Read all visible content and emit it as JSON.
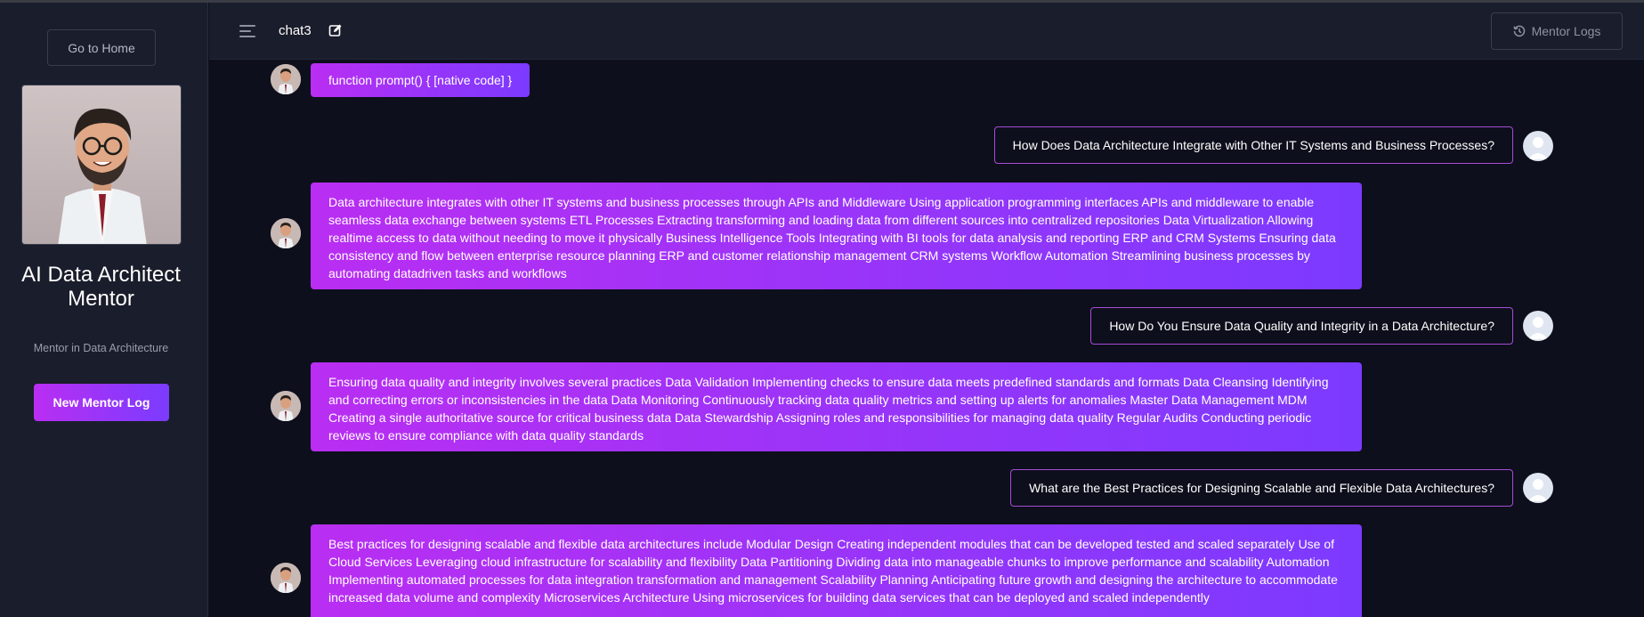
{
  "sidebar": {
    "home_label": "Go to Home",
    "mentor_name": "AI Data Architect Mentor",
    "mentor_subtitle": "Mentor in Data Architecture",
    "new_log_label": "New Mentor Log"
  },
  "header": {
    "chat_title": "chat3",
    "logs_label": "Mentor Logs"
  },
  "colors": {
    "accent_start": "#b92ef2",
    "accent_end": "#7a3cff",
    "background": "#0d0f1c",
    "panel": "#1a1d2b"
  },
  "messages": [
    {
      "role": "bot",
      "text": "function prompt() { [native code] }"
    },
    {
      "role": "user",
      "text": "How Does Data Architecture Integrate with Other IT Systems and Business Processes?"
    },
    {
      "role": "bot",
      "text": "Data architecture integrates with other IT systems and business processes through APIs and Middleware Using application programming interfaces APIs and middleware to enable seamless data exchange between systems ETL Processes Extracting transforming and loading data from different sources into centralized repositories Data Virtualization Allowing realtime access to data without needing to move it physically Business Intelligence Tools Integrating with BI tools for data analysis and reporting ERP and CRM Systems Ensuring data consistency and flow between enterprise resource planning ERP and customer relationship management CRM systems Workflow Automation Streamlining business processes by automating datadriven tasks and workflows"
    },
    {
      "role": "user",
      "text": "How Do You Ensure Data Quality and Integrity in a Data Architecture?"
    },
    {
      "role": "bot",
      "text": "Ensuring data quality and integrity involves several practices Data Validation Implementing checks to ensure data meets predefined standards and formats Data Cleansing Identifying and correcting errors or inconsistencies in the data Data Monitoring Continuously tracking data quality metrics and setting up alerts for anomalies Master Data Management MDM Creating a single authoritative source for critical business data Data Stewardship Assigning roles and responsibilities for managing data quality Regular Audits Conducting periodic reviews to ensure compliance with data quality standards"
    },
    {
      "role": "user",
      "text": "What are the Best Practices for Designing Scalable and Flexible Data Architectures?"
    },
    {
      "role": "bot",
      "text": "Best practices for designing scalable and flexible data architectures include Modular Design Creating independent modules that can be developed tested and scaled separately Use of Cloud Services Leveraging cloud infrastructure for scalability and flexibility Data Partitioning Dividing data into manageable chunks to improve performance and scalability Automation Implementing automated processes for data integration transformation and management Scalability Planning Anticipating future growth and designing the architecture to accommodate increased data volume and complexity Microservices Architecture Using microservices for building data services that can be deployed and scaled independently"
    }
  ]
}
